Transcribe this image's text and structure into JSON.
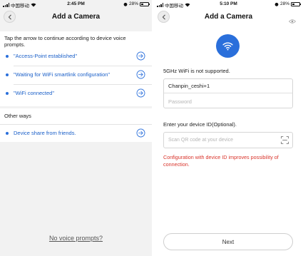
{
  "colors": {
    "accent": "#2a6fdb",
    "link_text": "#1a5fc8",
    "warning": "#d9342b",
    "left_background": "#f2f2f2"
  },
  "left_screen": {
    "status_bar": {
      "carrier": "中国移动",
      "time": "2:45 PM",
      "battery": "28%"
    },
    "header": {
      "back_icon": "chevron-left-icon",
      "title": "Add a Camera"
    },
    "instruction": "Tap the arrow to continue according to device voice prompts.",
    "voice_prompts": [
      {
        "label": "\"Access-Point established\"",
        "icon": "arrow-right-circle-icon"
      },
      {
        "label": "\"Waiting for WiFi smartlink configuration\"",
        "icon": "arrow-right-circle-icon"
      },
      {
        "label": "\"WiFi connected\"",
        "icon": "arrow-right-circle-icon"
      }
    ],
    "other_ways": {
      "title": "Other ways",
      "items": [
        {
          "label": "Device share from friends.",
          "icon": "arrow-right-circle-icon"
        }
      ]
    },
    "no_voice_link": "No voice prompts?"
  },
  "right_screen": {
    "status_bar": {
      "carrier": "中国移动",
      "time": "5:10 PM",
      "battery": "28%"
    },
    "header": {
      "back_icon": "chevron-left-icon",
      "title": "Add a Camera"
    },
    "wifi_icon": "wifi-icon",
    "wifi_note": "5GHz WiFi is not supported.",
    "ssid_value": "Chanpin_ceshi+1",
    "password_placeholder": "Password",
    "password_icon": "eye-icon",
    "device_id_label": "Enter your device ID(Optional).",
    "device_id_placeholder": "Scan QR code at your device",
    "scan_icon": "scan-icon",
    "config_warning": "Configuration with device ID improves possibility of connection.",
    "next_button": "Next"
  }
}
